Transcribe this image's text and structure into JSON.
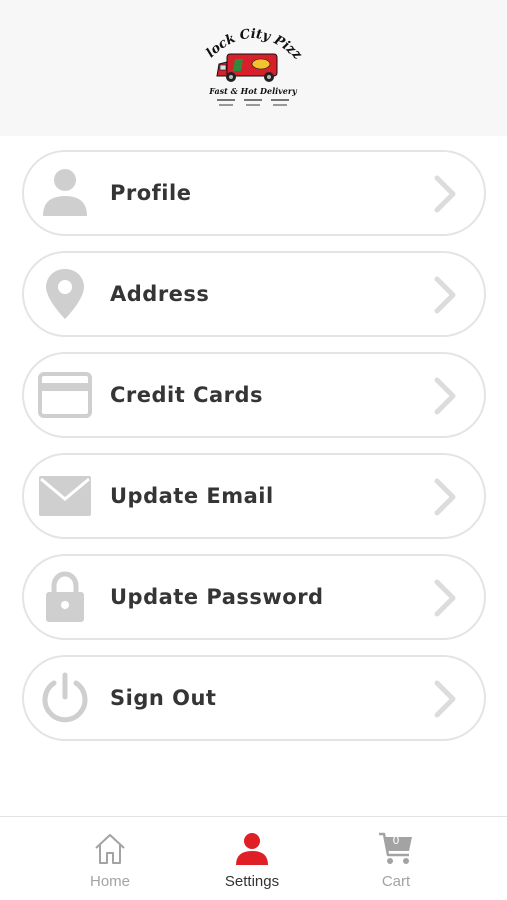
{
  "header": {
    "logo": {
      "title": "Block City Pizza",
      "tagline": "Fast & Hot Delivery"
    }
  },
  "menu": {
    "items": [
      {
        "label": "Profile",
        "icon": "person-icon"
      },
      {
        "label": "Address",
        "icon": "location-pin-icon"
      },
      {
        "label": "Credit Cards",
        "icon": "credit-card-icon"
      },
      {
        "label": "Update Email",
        "icon": "envelope-icon"
      },
      {
        "label": "Update Password",
        "icon": "padlock-icon"
      },
      {
        "label": "Sign Out",
        "icon": "power-icon"
      }
    ]
  },
  "tabbar": {
    "tabs": [
      {
        "label": "Home",
        "icon": "home-icon",
        "active": false
      },
      {
        "label": "Settings",
        "icon": "person-icon",
        "active": true
      },
      {
        "label": "Cart",
        "icon": "cart-icon",
        "active": false,
        "count": "0"
      }
    ]
  },
  "colors": {
    "accent": "#e01e26",
    "icon_gray": "#cfcfcf",
    "border": "#e4e4e4",
    "text": "#353535",
    "tab_inactive": "#a3a3a3"
  }
}
